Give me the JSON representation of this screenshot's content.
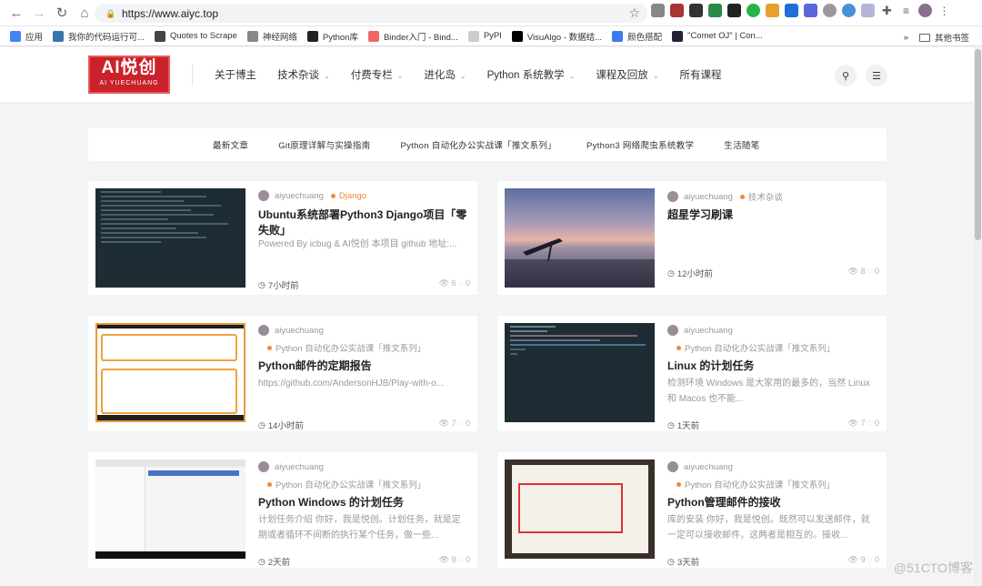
{
  "browser": {
    "url": "https://www.aiyc.top",
    "bookmarks": [
      {
        "label": "应用",
        "color": "#4285f4"
      },
      {
        "label": "我你的代码运行可...",
        "color": "#3776ab"
      },
      {
        "label": "Quotes to Scrape",
        "color": "#444"
      },
      {
        "label": "神经网络",
        "color": "#888"
      },
      {
        "label": "Python库",
        "color": "#222"
      },
      {
        "label": "Binder入门 - Bind...",
        "color": "#e66"
      },
      {
        "label": "PyPI",
        "color": "#ccc"
      },
      {
        "label": "VisuAlgo - 数据结...",
        "color": "#000"
      },
      {
        "label": "颜色搭配",
        "color": "#3b7bf0"
      },
      {
        "label": "\"Comet OJ\" | Con...",
        "color": "#223"
      }
    ],
    "more": "»",
    "other_bookmarks": "其他书签"
  },
  "site": {
    "logo_main": "AI悦创",
    "logo_sub": "AI YUECHUANG",
    "menu": [
      {
        "label": "关于博主",
        "caret": ""
      },
      {
        "label": "技术杂谈",
        "caret": "⌄"
      },
      {
        "label": "付费专栏",
        "caret": "⌄"
      },
      {
        "label": "进化岛",
        "caret": "⌄"
      },
      {
        "label": "Python 系统教学",
        "caret": "⌄"
      },
      {
        "label": "课程及回放",
        "caret": "⌄"
      },
      {
        "label": "所有课程",
        "caret": ""
      }
    ],
    "subnav": [
      "最新文章",
      "Git原理详解与实操指南",
      "Python 自动化办公实战课「推文系列」",
      "Python3 网络爬虫系统教学",
      "生活随笔"
    ]
  },
  "posts": [
    {
      "author": "aiyuechuang",
      "category": "Django",
      "title": "Ubuntu系统部署Python3 Django项目「零失败」",
      "excerpt": "Powered By icbug & AI悦创 本项目 github 地址:...",
      "time": "7小时前",
      "views": "6",
      "comments": "0"
    },
    {
      "author": "aiyuechuang",
      "category": "技术杂谈",
      "title": "超星学习刷课",
      "excerpt": "",
      "time": "12小时前",
      "views": "8",
      "comments": "0"
    },
    {
      "author": "aiyuechuang",
      "category": "Python 自动化办公实战课「推文系列」",
      "title": "Python邮件的定期报告",
      "excerpt": "https://github.com/AndersonHJB/Play-with-o...",
      "time": "14小时前",
      "views": "7",
      "comments": "0"
    },
    {
      "author": "aiyuechuang",
      "category": "Python 自动化办公实战课「推文系列」",
      "title": "Linux 的计划任务",
      "excerpt": "检测环境 Windows 是大家用的最多的，当然 Linux 和 Macos 也不能...",
      "time": "1天前",
      "views": "7",
      "comments": "0"
    },
    {
      "author": "aiyuechuang",
      "category": "Python 自动化办公实战课「推文系列」",
      "title": "Python Windows 的计划任务",
      "excerpt": "计划任务介绍 你好，我是悦创。计划任务，就是定期或者循环不间断的执行某个任务，做一些...",
      "time": "2天前",
      "views": "9",
      "comments": "0"
    },
    {
      "author": "aiyuechuang",
      "category": "Python 自动化办公实战课「推文系列」",
      "title": "Python管理邮件的接收",
      "excerpt": "库的安装 你好，我是悦创。既然可以发送邮件，就一定可以接收邮件，这两者是相互的。接收...",
      "time": "3天前",
      "views": "9",
      "comments": "0"
    }
  ],
  "watermark": "@51CTO博客"
}
